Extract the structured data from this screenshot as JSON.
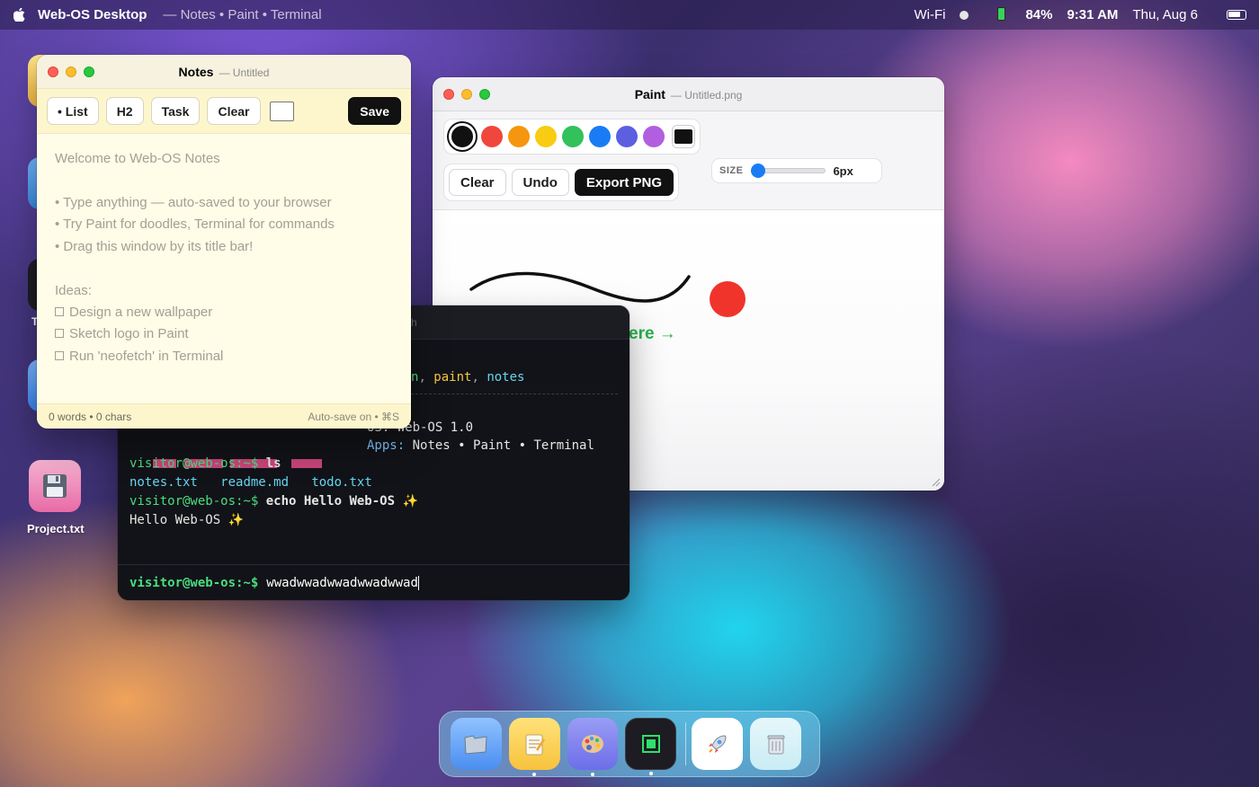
{
  "menubar": {
    "apple_icon": "apple-logo-icon",
    "app_title": "Web-OS Desktop",
    "subtitle": "— Notes • Paint • Terminal",
    "wifi": "Wi-Fi",
    "battery": "84%",
    "time": "9:31 AM",
    "date": "Thu, Aug 6"
  },
  "desktop_icons": [
    {
      "label": "Project.txt",
      "icon": "floppy-disk-icon"
    }
  ],
  "notes": {
    "title": "Notes",
    "doc": "— Untitled",
    "toolbar": {
      "list": "• List",
      "h2": "H2",
      "task": "Task",
      "clear": "Clear",
      "save": "Save"
    },
    "lines": [
      "Welcome to Web-OS Notes",
      "• Type anything — auto-saved to your browser",
      "• Try Paint for doodles, Terminal for commands",
      "• Drag this window by its title bar!",
      "Ideas:",
      "Design a new wallpaper",
      "Sketch logo in Paint",
      "Run 'neofetch' in Terminal"
    ],
    "status_left": "0 words • 0 chars",
    "status_right": "Auto-save on • ⌘S"
  },
  "paint": {
    "title": "Paint",
    "doc": "— Untitled.png",
    "palette": [
      "#111111",
      "#f0473c",
      "#f6960e",
      "#f8cc12",
      "#32c15a",
      "#1a7cf5",
      "#5b5fe0",
      "#b15ee0"
    ],
    "selected_color": "#111111",
    "size_label": "SIZE",
    "size_value": "6px",
    "size_fraction": 0.08,
    "buttons": {
      "clear": "Clear",
      "undo": "Undo",
      "export": "Export PNG"
    },
    "canvas_text": "ere →"
  },
  "terminal": {
    "title_fragment": "h",
    "lines": {
      "apps_fragment": "n, paint, notes",
      "os": "OS: Web-OS 1.0",
      "apps_label": "Apps:",
      "apps_value": " Notes • Paint • Terminal",
      "prompt": "visitor@web-os:~$",
      "cmd1": " ls",
      "ls_out": [
        "notes.txt",
        "readme.md",
        "todo.txt"
      ],
      "cmd2": " echo Hello Web-OS ✨",
      "echo_out": "Hello Web-OS ✨"
    },
    "input_prompt": "visitor@web-os:~$",
    "input_value": "wwadwwadwwadwwadwwad"
  },
  "dock": {
    "items": [
      {
        "name": "finder",
        "icon": "folder-icon",
        "running": false
      },
      {
        "name": "notes",
        "icon": "notepad-icon",
        "running": true
      },
      {
        "name": "paint",
        "icon": "palette-icon",
        "running": true
      },
      {
        "name": "terminal",
        "icon": "terminal-icon",
        "running": true
      },
      {
        "name": "launchpad",
        "icon": "rocket-icon",
        "running": false
      },
      {
        "name": "trash",
        "icon": "trash-icon",
        "running": false
      }
    ]
  }
}
